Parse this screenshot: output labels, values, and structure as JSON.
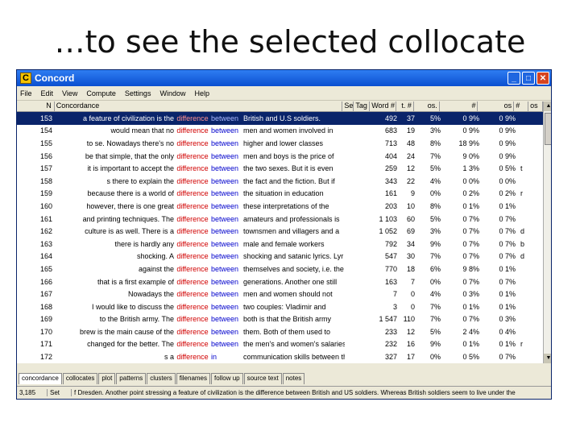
{
  "slide": {
    "title": "…to see the selected collocate"
  },
  "window": {
    "title": "Concord",
    "icon_letter": "C",
    "buttons": [
      "_",
      "□",
      "✕"
    ]
  },
  "menu": [
    "File",
    "Edit",
    "View",
    "Compute",
    "Settings",
    "Window",
    "Help"
  ],
  "columns": [
    "N",
    "Concordance",
    "Set",
    "Tag",
    "Word #",
    "t. #",
    "os.",
    "#",
    "os",
    "#",
    "os"
  ],
  "rows": [
    {
      "n": "153",
      "left": "a feature of civilization is the",
      "node": "difference",
      "col": "between",
      "right": "British and U.S soldiers.",
      "set": "",
      "tag": "",
      "word": "492",
      "tpos": "37",
      "pc": "5%",
      "p1": "0 9%",
      "p2": "0 9%",
      "ext": ""
    },
    {
      "n": "154",
      "left": "would mean that no",
      "node": "difference",
      "col": "between",
      "right": "men and women involved in",
      "set": "",
      "tag": "",
      "word": "683",
      "tpos": "19",
      "pc": "3%",
      "p1": "0 9%",
      "p2": "0 9%",
      "ext": ""
    },
    {
      "n": "155",
      "left": "to se. Nowadays there's no",
      "node": "difference",
      "col": "between",
      "right": "higher and lower classes",
      "set": "",
      "tag": "",
      "word": "713",
      "tpos": "48",
      "pc": "8%",
      "p1": "18 9%",
      "p2": "0 9%",
      "ext": ""
    },
    {
      "n": "156",
      "left": "be that simple, that the only",
      "node": "difference",
      "col": "between",
      "right": "men and boys is the price of",
      "set": "",
      "tag": "",
      "word": "404",
      "tpos": "24",
      "pc": "7%",
      "p1": "9 0%",
      "p2": "0 9%",
      "ext": ""
    },
    {
      "n": "157",
      "left": "it is important to accept the",
      "node": "difference",
      "col": "between",
      "right": "the two sexes. But it is even",
      "set": "",
      "tag": "",
      "word": "259",
      "tpos": "12",
      "pc": "5%",
      "p1": "1 3%",
      "p2": "0 5%",
      "ext": "t"
    },
    {
      "n": "158",
      "left": "s there to explain the",
      "node": "difference",
      "col": "between",
      "right": "the fact and the fiction. But if",
      "set": "",
      "tag": "",
      "word": "343",
      "tpos": "22",
      "pc": "4%",
      "p1": "0 0%",
      "p2": "0 0%",
      "ext": ""
    },
    {
      "n": "159",
      "left": "because there is a world of",
      "node": "difference",
      "col": "between",
      "right": "the situation in education",
      "set": "",
      "tag": "",
      "word": "161",
      "tpos": "9",
      "pc": "0%",
      "p1": "0 2%",
      "p2": "0 2%",
      "ext": "r"
    },
    {
      "n": "160",
      "left": "however, there is one great",
      "node": "difference",
      "col": "between",
      "right": "these interpretations of the",
      "set": "",
      "tag": "",
      "word": "203",
      "tpos": "10",
      "pc": "8%",
      "p1": "0 1%",
      "p2": "0 1%",
      "ext": ""
    },
    {
      "n": "161",
      "left": "and printing techniques. The",
      "node": "difference",
      "col": "between",
      "right": "amateurs and professionals is",
      "set": "",
      "tag": "",
      "word": "1 103",
      "tpos": "60",
      "pc": "5%",
      "p1": "0 7%",
      "p2": "0 7%",
      "ext": ""
    },
    {
      "n": "162",
      "left": "culture is as well. There is a",
      "node": "difference",
      "col": "between",
      "right": "townsmen and villagers and a",
      "set": "",
      "tag": "",
      "word": "1 052",
      "tpos": "69",
      "pc": "3%",
      "p1": "0 7%",
      "p2": "0 7%",
      "ext": "d"
    },
    {
      "n": "163",
      "left": "there is hardly any",
      "node": "difference",
      "col": "between",
      "right": "male and female workers",
      "set": "",
      "tag": "",
      "word": "792",
      "tpos": "34",
      "pc": "9%",
      "p1": "0 7%",
      "p2": "0 7%",
      "ext": "b"
    },
    {
      "n": "164",
      "left": "shocking. A",
      "node": "difference",
      "col": "between",
      "right": "shocking and satanic lyrics. Lyr",
      "set": "",
      "tag": "",
      "word": "547",
      "tpos": "30",
      "pc": "7%",
      "p1": "0 7%",
      "p2": "0 7%",
      "ext": "d"
    },
    {
      "n": "165",
      "left": "against the",
      "node": "difference",
      "col": "between",
      "right": "themselves and society, i.e. the",
      "set": "",
      "tag": "",
      "word": "770",
      "tpos": "18",
      "pc": "6%",
      "p1": "9 8%",
      "p2": "0 1%",
      "ext": ""
    },
    {
      "n": "166",
      "left": "that is a first example of",
      "node": "difference",
      "col": "between",
      "right": "generations. Another one still",
      "set": "",
      "tag": "",
      "word": "163",
      "tpos": "7",
      "pc": "0%",
      "p1": "0 7%",
      "p2": "0 7%",
      "ext": ""
    },
    {
      "n": "167",
      "left": "Nowadays the",
      "node": "difference",
      "col": "between",
      "right": "men and women should not",
      "set": "",
      "tag": "",
      "word": "7",
      "tpos": "0",
      "pc": "4%",
      "p1": "0 3%",
      "p2": "0 1%",
      "ext": ""
    },
    {
      "n": "168",
      "left": "I would like to discuss the",
      "node": "difference",
      "col": "between",
      "right": "two couples: Vladimir and",
      "set": "",
      "tag": "",
      "word": "3",
      "tpos": "0",
      "pc": "7%",
      "p1": "0 1%",
      "p2": "0 1%",
      "ext": ""
    },
    {
      "n": "169",
      "left": "to the British army. The",
      "node": "difference",
      "col": "between",
      "right": "both is that the British army",
      "set": "",
      "tag": "",
      "word": "1 547",
      "tpos": "110",
      "pc": "7%",
      "p1": "0 7%",
      "p2": "0 3%",
      "ext": ""
    },
    {
      "n": "170",
      "left": "brew is the main cause of the",
      "node": "difference",
      "col": "between",
      "right": "them. Both of them used to",
      "set": "",
      "tag": "",
      "word": "233",
      "tpos": "12",
      "pc": "5%",
      "p1": "2 4%",
      "p2": "0 4%",
      "ext": ""
    },
    {
      "n": "171",
      "left": "changed for the better. The",
      "node": "difference",
      "col": "between",
      "right": "the men's and women's salaries",
      "set": "",
      "tag": "",
      "word": "232",
      "tpos": "16",
      "pc": "9%",
      "p1": "0 1%",
      "p2": "0 1%",
      "ext": "r"
    },
    {
      "n": "172",
      "left": "s a",
      "node": "difference",
      "col": "in",
      "right": "communication skills between those high and low",
      "set": "",
      "tag": "",
      "word": "327",
      "tpos": "17",
      "pc": "0%",
      "p1": "0 5%",
      "p2": "0 7%",
      "ext": ""
    }
  ],
  "tabs": [
    "concordance",
    "collocates",
    "plot",
    "patterns",
    "clusters",
    "filenames",
    "follow up",
    "source text",
    "notes"
  ],
  "status": {
    "count": "3,185",
    "mode": "Set",
    "text": "f Dresden. Another point stressing a feature of civilization is the difference between British and US soldiers. Whereas British soldiers seem to live under the"
  },
  "colors": {
    "node": "#d10000",
    "collocate": "#0000cc",
    "selected_row": "#0a246a"
  }
}
